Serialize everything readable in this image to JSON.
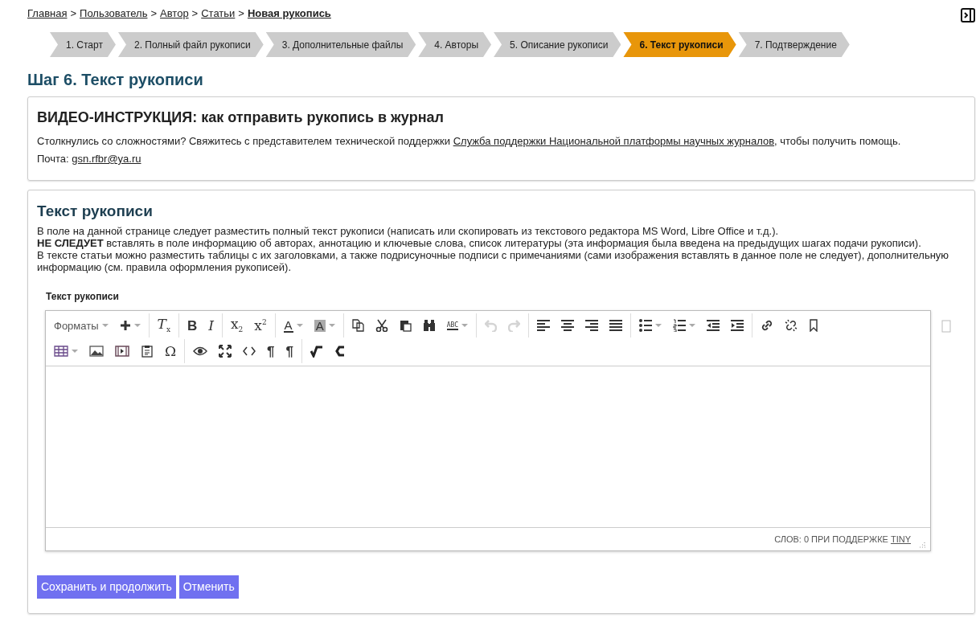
{
  "breadcrumbs": [
    {
      "label": "Главная",
      "current": false
    },
    {
      "label": "Пользователь",
      "current": false
    },
    {
      "label": "Автор",
      "current": false
    },
    {
      "label": "Статьи",
      "current": false
    },
    {
      "label": "Новая рукопись",
      "current": true
    }
  ],
  "breadcrumb_separator": ">",
  "steps": [
    {
      "label": "1. Старт",
      "selected": false
    },
    {
      "label": "2. Полный файл рукописи",
      "selected": false
    },
    {
      "label": "3. Дополнительные файлы",
      "selected": false
    },
    {
      "label": "4. Авторы",
      "selected": false
    },
    {
      "label": "5. Описание рукописи",
      "selected": false
    },
    {
      "label": "6. Текст рукописи",
      "selected": true
    },
    {
      "label": "7. Подтверждение",
      "selected": false
    }
  ],
  "page_title": "Шаг 6. Текст рукописи",
  "video_card": {
    "title": "ВИДЕО-ИНСТРУКЦИЯ: как отправить рукопись в журнал",
    "text_before": "Столкнулись со сложностями? Свяжитесь с представителем технической поддержки ",
    "link": "Служба поддержки Национальной платформы научных журналов",
    "text_after": ", чтобы получить помощь.",
    "mail_label": "Почта: ",
    "mail": "gsn.rfbr@ya.ru"
  },
  "text_card": {
    "title": "Текст рукописи",
    "paragraphs": [
      "В поле на данной странице следует разместить полный текст рукописи (написать или скопировать из текстового редактора MS Word, Libre Office и т.д.).",
      "**НЕ СЛЕДУЕТ** вставлять в поле информацию об авторах, аннотацию и ключевые слова, список литературы (эта информация была введена на предыдущих шагах подачи рукописи).",
      "В тексте статьи можно разместить таблицы с их заголовками, а также подрисуночные подписи с примечаниями (сами изображения вставлять в данное поле не следует), дополнительную информацию (см. правила оформления рукописей)."
    ],
    "field_label": "Текст рукописи",
    "editor": {
      "toolbar_rows": [
        [
          [
            {
              "kind": "menu",
              "label": "Форматы",
              "dropdown": true
            },
            {
              "kind": "icon",
              "dropdown": true
            }
          ],
          [
            {
              "kind": "glyph",
              "label": "*T*$_{x}$"
            }
          ],
          [
            {
              "kind": "glyph",
              "label": "B",
              "bold": true
            },
            {
              "kind": "glyph",
              "label": "I",
              "italic": true
            }
          ],
          [
            {
              "kind": "glyph",
              "label": "x$_{2}$"
            },
            {
              "kind": "glyph",
              "label": "x$^{2}$"
            }
          ],
          [
            {
              "kind": "textcolor",
              "label": "A",
              "dropdown": true
            },
            {
              "kind": "bgcolor",
              "label": "A",
              "dropdown": true
            }
          ],
          [
            {
              "kind": "icon"
            },
            {
              "kind": "icon"
            },
            {
              "kind": "icon"
            },
            {
              "kind": "icon"
            },
            {
              "kind": "spell",
              "label": "ABC",
              "dropdown": true
            }
          ],
          [
            {
              "kind": "icon",
              "disabled": true
            },
            {
              "kind": "icon",
              "disabled": true
            }
          ],
          [
            {
              "kind": "icon"
            },
            {
              "kind": "icon"
            },
            {
              "kind": "icon"
            },
            {
              "kind": "icon"
            }
          ],
          [
            {
              "kind": "icon",
              "dropdown": true
            },
            {
              "kind": "icon",
              "dropdown": true
            },
            {
              "kind": "icon"
            },
            {
              "kind": "icon"
            }
          ],
          [
            {
              "kind": "icon"
            },
            {
              "kind": "icon"
            },
            {
              "kind": "icon"
            }
          ]
        ],
        [
          [
            {
              "kind": "icon",
              "dropdown": true
            },
            {
              "kind": "icon"
            },
            {
              "kind": "icon"
            },
            {
              "kind": "icon"
            },
            {
              "kind": "glyph",
              "label": "Ω"
            }
          ],
          [
            {
              "kind": "icon"
            },
            {
              "kind": "icon"
            },
            {
              "kind": "icon"
            },
            {
              "kind": "glyph",
              "label": "¶",
              "bold": true
            },
            {
              "kind": "glyph",
              "label": "¶",
              "bold": true
            }
          ],
          [
            {
              "kind": "icon"
            },
            {
              "kind": "icon"
            }
          ]
        ]
      ],
      "status": "СЛОВ: 0 ПРИ ПОДДЕРЖКЕ ",
      "status_link": "TINY"
    },
    "buttons": [
      {
        "label": "Сохранить и продолжить"
      },
      {
        "label": "Отменить"
      }
    ]
  }
}
